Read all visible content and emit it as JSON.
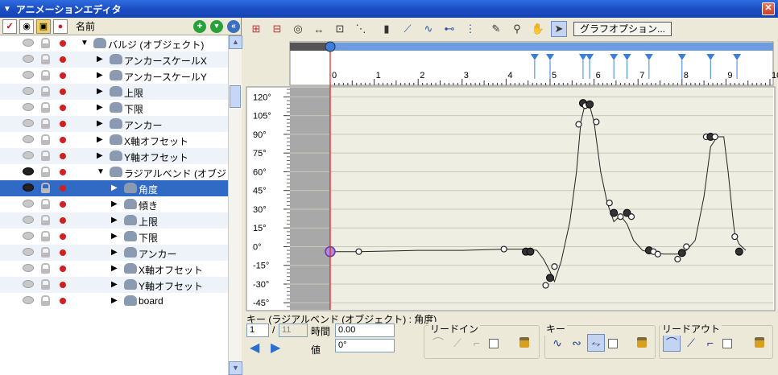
{
  "window": {
    "title": "アニメーションエディタ",
    "collapse_icon": "triangle-down-icon",
    "close_icon": "close-x-icon"
  },
  "layer_panel": {
    "header_name": "名前",
    "header_icons": [
      "checkmark-icon",
      "eye-icon",
      "lock-icon",
      "record-dot-icon"
    ],
    "header_buttons": [
      "add-green-icon",
      "expand-green-icon",
      "collapse-blue-icon"
    ],
    "rows": [
      {
        "label": "バルジ (オブジェクト)",
        "depth": 0,
        "eye": false,
        "selected": false
      },
      {
        "label": "アンカースケールX",
        "depth": 1,
        "eye": false,
        "selected": false
      },
      {
        "label": "アンカースケールY",
        "depth": 1,
        "eye": false,
        "selected": false
      },
      {
        "label": "上限",
        "depth": 1,
        "eye": false,
        "selected": false
      },
      {
        "label": "下限",
        "depth": 1,
        "eye": false,
        "selected": false
      },
      {
        "label": "アンカー",
        "depth": 1,
        "eye": false,
        "selected": false
      },
      {
        "label": "X軸オフセット",
        "depth": 1,
        "eye": false,
        "selected": false
      },
      {
        "label": "Y軸オフセット",
        "depth": 1,
        "eye": false,
        "selected": false
      },
      {
        "label": "ラジアルベンド (オブジ・..",
        "depth": 1,
        "eye": true,
        "selected": false
      },
      {
        "label": "角度",
        "depth": 2,
        "eye": true,
        "selected": true
      },
      {
        "label": "傾き",
        "depth": 2,
        "eye": false,
        "selected": false
      },
      {
        "label": "上限",
        "depth": 2,
        "eye": false,
        "selected": false
      },
      {
        "label": "下限",
        "depth": 2,
        "eye": false,
        "selected": false
      },
      {
        "label": "アンカー",
        "depth": 2,
        "eye": false,
        "selected": false
      },
      {
        "label": "X軸オフセット",
        "depth": 2,
        "eye": false,
        "selected": false
      },
      {
        "label": "Y軸オフセット",
        "depth": 2,
        "eye": false,
        "selected": false
      },
      {
        "label": "board",
        "depth": 2,
        "eye": false,
        "selected": false
      }
    ]
  },
  "toolbar": {
    "icons": [
      "add-key-icon",
      "delete-key-icon",
      "view-all-icon",
      "fit-horizontal-icon",
      "fit-key-icon",
      "select-key-icon",
      "trash-icon",
      "linear-key-icon",
      "smooth-key-icon",
      "hold-key-icon",
      "step-key-icon",
      "pen-add-icon",
      "zoom-icon",
      "hand-icon",
      "pointer-icon"
    ],
    "active_tool": "pointer-icon",
    "graph_options_label": "グラフオプション..."
  },
  "timeline": {
    "frame_labels": [
      "0",
      "1",
      "2",
      "3",
      "4",
      "5",
      "6",
      "7",
      "8",
      "9",
      "10"
    ],
    "current_frame": 0,
    "key_markers": [
      4.65,
      5.0,
      5.75,
      5.9,
      6.45,
      6.75,
      7.25,
      8.0,
      8.65,
      9.25
    ]
  },
  "chart_data": {
    "type": "line",
    "xlim": [
      0,
      10
    ],
    "ylim": [
      -50,
      128
    ],
    "y_ticks": [
      120,
      105,
      90,
      75,
      60,
      45,
      30,
      15,
      0,
      -15,
      -30,
      -45
    ],
    "y_tick_labels": [
      "120°",
      "105°",
      "90°",
      "75°",
      "60°",
      "45°",
      "30°",
      "15°",
      "0°",
      "-15°",
      "-30°",
      "-45°"
    ],
    "grid": true,
    "x": [
      0,
      0.65,
      2,
      3,
      4,
      4.3,
      4.5,
      4.7,
      4.85,
      5.0,
      5.1,
      5.25,
      5.45,
      5.6,
      5.7,
      5.8,
      5.9,
      6.0,
      6.15,
      6.3,
      6.45,
      6.6,
      6.75,
      6.9,
      7.1,
      7.3,
      7.6,
      7.9,
      8.1,
      8.3,
      8.5,
      8.65,
      8.8,
      8.95,
      9.05,
      9.15,
      9.2,
      9.3,
      9.45
    ],
    "y": [
      -4,
      -4,
      -3,
      -3,
      -2,
      -2,
      -2,
      -3,
      -10,
      -20,
      -28,
      -12,
      20,
      60,
      100,
      115,
      113,
      100,
      60,
      35,
      20,
      25,
      18,
      5,
      -3,
      -5,
      -6,
      -6,
      -3,
      5,
      40,
      80,
      88,
      88,
      60,
      25,
      10,
      2,
      -3
    ],
    "key_points": [
      {
        "x": 0,
        "y": -4,
        "style": "current"
      },
      {
        "x": 0.65,
        "y": -4,
        "style": "hollow"
      },
      {
        "x": 3.95,
        "y": -2,
        "style": "hollow"
      },
      {
        "x": 4.45,
        "y": -4,
        "style": "solid"
      },
      {
        "x": 4.55,
        "y": -4,
        "style": "solid"
      },
      {
        "x": 4.9,
        "y": -31,
        "style": "hollow"
      },
      {
        "x": 5.0,
        "y": -25,
        "style": "solid"
      },
      {
        "x": 5.1,
        "y": -16,
        "style": "hollow"
      },
      {
        "x": 5.65,
        "y": 98,
        "style": "hollow"
      },
      {
        "x": 5.75,
        "y": 115,
        "style": "solid"
      },
      {
        "x": 5.8,
        "y": 113,
        "style": "hollow"
      },
      {
        "x": 5.9,
        "y": 114,
        "style": "solid"
      },
      {
        "x": 6.05,
        "y": 100,
        "style": "hollow"
      },
      {
        "x": 6.35,
        "y": 35,
        "style": "hollow"
      },
      {
        "x": 6.45,
        "y": 27,
        "style": "solid"
      },
      {
        "x": 6.6,
        "y": 24,
        "style": "hollow"
      },
      {
        "x": 6.75,
        "y": 27,
        "style": "solid"
      },
      {
        "x": 6.85,
        "y": 24,
        "style": "hollow"
      },
      {
        "x": 7.25,
        "y": -3,
        "style": "solid"
      },
      {
        "x": 7.35,
        "y": -4,
        "style": "hollow"
      },
      {
        "x": 7.45,
        "y": -6,
        "style": "hollow"
      },
      {
        "x": 7.9,
        "y": -10,
        "style": "hollow"
      },
      {
        "x": 8.0,
        "y": -5,
        "style": "solid"
      },
      {
        "x": 8.1,
        "y": 0,
        "style": "hollow"
      },
      {
        "x": 8.55,
        "y": 88,
        "style": "hollow"
      },
      {
        "x": 8.65,
        "y": 88,
        "style": "solid"
      },
      {
        "x": 8.75,
        "y": 88,
        "style": "hollow"
      },
      {
        "x": 9.2,
        "y": 8,
        "style": "hollow"
      },
      {
        "x": 9.3,
        "y": -4,
        "style": "solid"
      }
    ]
  },
  "key_panel": {
    "title": "キー (ラジアルベンド (オブジェクト) : 角度)",
    "key_index": "1",
    "separator": "/",
    "key_total": "11",
    "time_label": "時間",
    "time_value": "0.00",
    "value_label": "値",
    "value_value": "0°",
    "nav_icons": [
      "arrow-left-icon",
      "arrow-right-icon"
    ],
    "leadin_title": "リードイン",
    "key_title": "キー",
    "leadout_title": "リードアウト"
  },
  "colors": {
    "titlebar": "#1b4fc4",
    "selection": "#316ac5",
    "graph_bg": "#efeee2",
    "timeline_bar": "#6d9ce0",
    "key_marker": "#3d7fd8",
    "current_line": "#e02020"
  }
}
